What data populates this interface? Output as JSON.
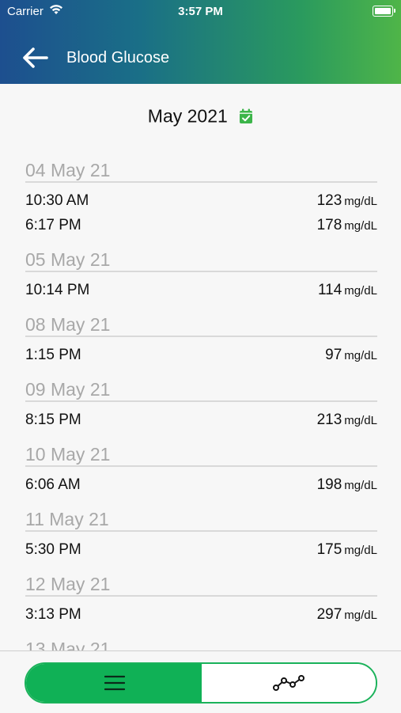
{
  "status_bar": {
    "carrier": "Carrier",
    "time": "3:57 PM"
  },
  "header": {
    "title": "Blood Glucose",
    "back_icon": "arrow-left-icon"
  },
  "period": {
    "label": "May 2021",
    "icon": "calendar-check-icon",
    "icon_color": "#3cb54a"
  },
  "unit": "mg/dL",
  "groups": [
    {
      "date": "04 May 21",
      "entries": [
        {
          "time": "10:30 AM",
          "value": "123"
        },
        {
          "time": "6:17 PM",
          "value": "178"
        }
      ]
    },
    {
      "date": "05 May 21",
      "entries": [
        {
          "time": "10:14 PM",
          "value": "114"
        }
      ]
    },
    {
      "date": "08 May 21",
      "entries": [
        {
          "time": "1:15 PM",
          "value": "97"
        }
      ]
    },
    {
      "date": "09 May 21",
      "entries": [
        {
          "time": "8:15 PM",
          "value": "213"
        }
      ]
    },
    {
      "date": "10 May 21",
      "entries": [
        {
          "time": "6:06 AM",
          "value": "198"
        }
      ]
    },
    {
      "date": "11 May 21",
      "entries": [
        {
          "time": "5:30 PM",
          "value": "175"
        }
      ]
    },
    {
      "date": "12 May 21",
      "entries": [
        {
          "time": "3:13 PM",
          "value": "297"
        }
      ]
    },
    {
      "date": "13 May 21",
      "entries": []
    }
  ],
  "view_toggle": {
    "options": [
      {
        "id": "list",
        "icon": "list-icon",
        "selected": true
      },
      {
        "id": "chart",
        "icon": "line-chart-icon",
        "selected": false
      }
    ],
    "accent_color": "#10b156"
  }
}
